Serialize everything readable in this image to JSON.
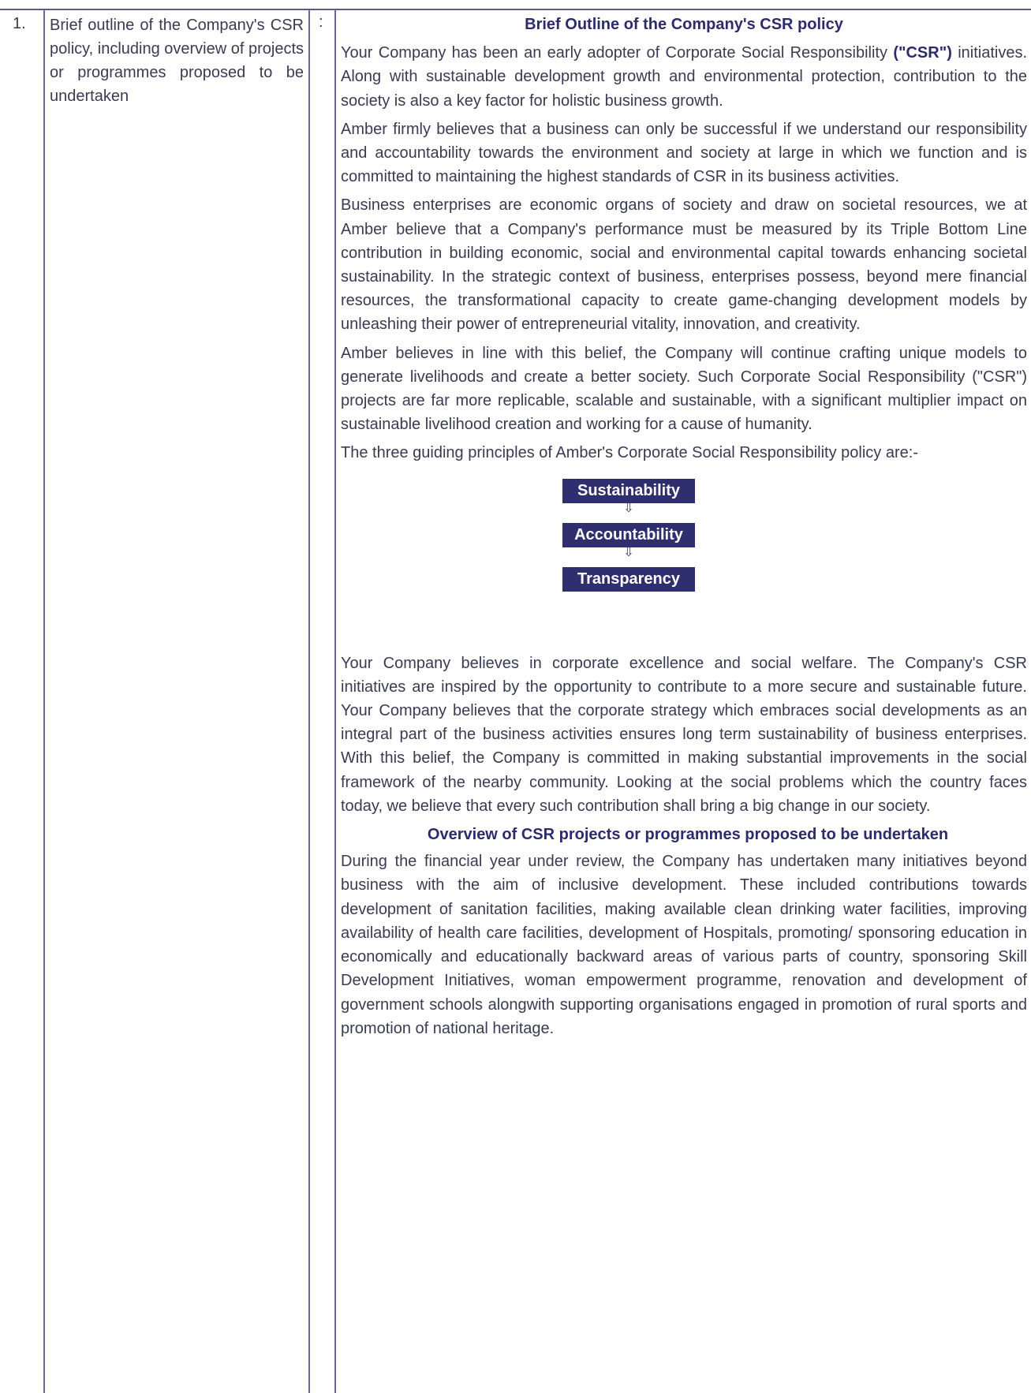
{
  "row": {
    "number": "1.",
    "label": "Brief outline of the Company's CSR policy, including overview of projects or programmes proposed to be undertaken",
    "separator": ":"
  },
  "content": {
    "heading": "Brief Outline of the Company's CSR policy",
    "p1_before": "Your Company has been an early adopter of Corporate Social Responsibility",
    "p1_strong": "(\"CSR\")",
    "p1_after": "initiatives. Along with sustainable development growth and environmental protection, contribution to the society is also a key factor for holistic business growth.",
    "p2": "Amber firmly believes that a business can only be successful if we understand our responsibility and accountability towards the environment and society at large in which we function and is committed to maintaining the highest standards of CSR in its business activities.",
    "p3": "Business enterprises are economic organs of society and draw on societal resources, we at Amber believe that a Company's performance must be measured by its Triple Bottom Line contribution in building economic, social and environmental capital towards enhancing societal sustainability. In the strategic context of business, enterprises possess, beyond mere financial resources, the transformational capacity to create game-changing development models by unleashing their power of entrepreneurial vitality, innovation, and creativity.",
    "p4": "Amber believes in line with this belief, the Company will continue crafting unique models to generate livelihoods and create a better society. Such Corporate Social Responsibility (\"CSR\") projects are far more replicable, scalable and sustainable, with a significant multiplier impact on sustainable livelihood creation and working for a cause of humanity.",
    "p5": "The three guiding principles of Amber's Corporate Social Responsibility policy are:-",
    "principles": [
      "Sustainability",
      "Accountability",
      "Transparency"
    ],
    "arrow_glyph": "⇩",
    "p6": "Your Company believes in corporate excellence and social welfare. The Company's CSR initiatives are inspired by the opportunity to contribute to a more secure and sustainable future. Your Company believes that the corporate strategy which embraces social developments as an integral part of the business activities ensures long term sustainability of business enterprises. With this belief, the Company is committed in making substantial improvements in the social framework of the nearby community. Looking at the social problems which the country faces today, we believe that every such contribution shall bring a big change in our society.",
    "heading2": "Overview of CSR projects or programmes proposed to be undertaken",
    "p7": "During the financial year under review, the Company has undertaken many initiatives beyond business with the aim of inclusive development. These included contributions towards development of sanitation facilities, making available clean drinking water facilities, improving availability of health care facilities, development of Hospitals, promoting/ sponsoring education in economically and educationally backward areas of various parts of country, sponsoring Skill Development Initiatives, woman empowerment programme, renovation and development of government schools alongwith supporting organisations engaged in promotion of rural sports and promotion of national heritage."
  }
}
